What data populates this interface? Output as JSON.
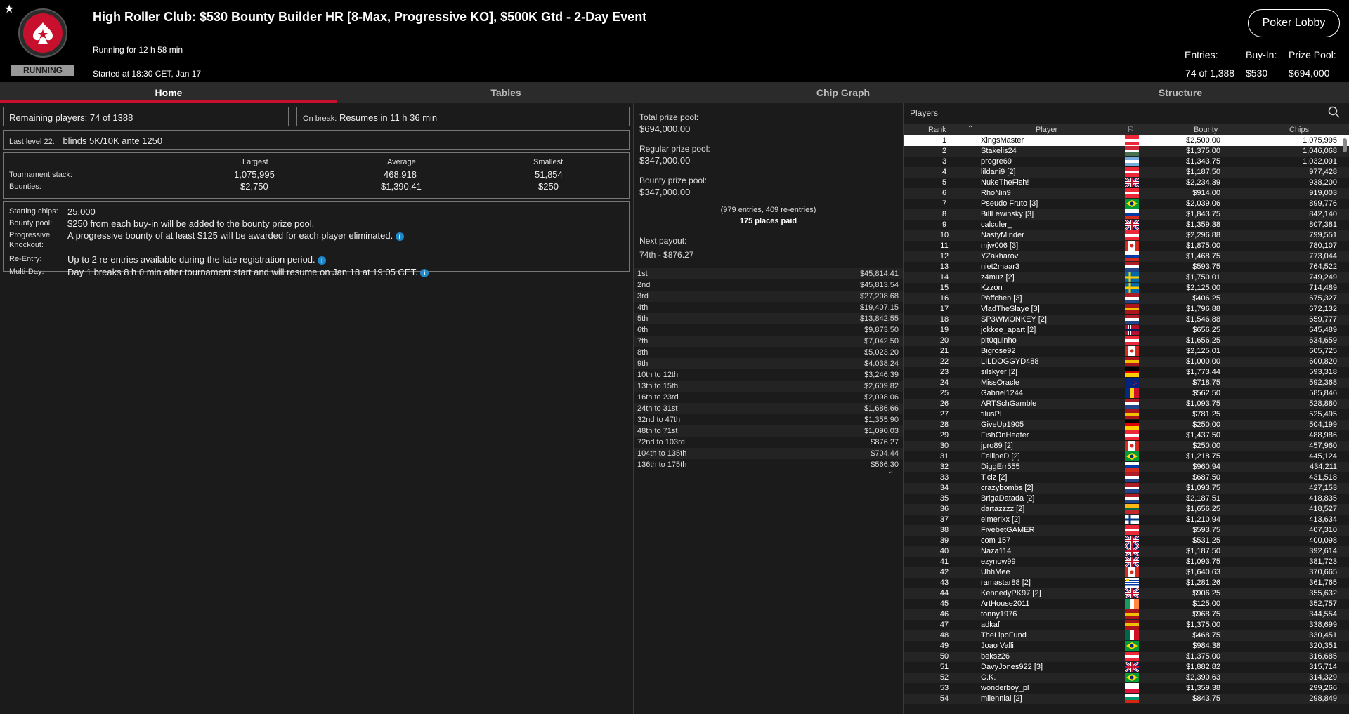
{
  "header": {
    "title": "High Roller Club: $530 Bounty Builder HR [8-Max, Progressive KO], $500K Gtd - 2-Day Event",
    "running_for": "Running for 12 h 58 min",
    "started_at": "Started at 18:30 CET, Jan 17",
    "status_ribbon": "RUNNING",
    "lobby_button": "Poker Lobby",
    "entries_label": "Entries:",
    "entries_value": "74 of 1,388",
    "buyin_label": "Buy-In:",
    "buyin_value": "$530",
    "prizepool_label": "Prize Pool:",
    "prizepool_value": "$694,000",
    "accent_color": "#c8102e"
  },
  "tabs": [
    "Home",
    "Tables",
    "Chip Graph",
    "Structure"
  ],
  "home": {
    "remaining_label": "Remaining players:",
    "remaining_value": "74 of 1388",
    "onbreak_label": "On break:",
    "onbreak_value": "Resumes in 11 h 36 min",
    "lastlevel_label": "Last level 22:",
    "lastlevel_value": "blinds 5K/10K ante 1250",
    "stats": {
      "col_largest": "Largest",
      "col_average": "Average",
      "col_smallest": "Smallest",
      "row_stack": "Tournament stack:",
      "row_bounties": "Bounties:",
      "stack_largest": "1,075,995",
      "stack_average": "468,918",
      "stack_smallest": "51,854",
      "bounty_largest": "$2,750",
      "bounty_average": "$1,390.41",
      "bounty_smallest": "$250"
    },
    "info": {
      "starting_label": "Starting chips:",
      "starting_value": "25,000",
      "bounty_label": "Bounty pool:",
      "bounty_value": "$250 from each buy-in will be added to the bounty prize pool.",
      "pko_label1": "Progressive",
      "pko_label2": "Knockout:",
      "pko_value": "A progressive bounty of at least $125 will be awarded for each player eliminated.",
      "reentry_label": "Re-Entry:",
      "reentry_value": "Up to 2 re-entries available during the late registration period.",
      "multiday_label": "Multi-Day:",
      "multiday_value": "Day 1 breaks 8 h 0 min after tournament start and will resume on Jan 18 at 19:05 CET."
    }
  },
  "prize": {
    "total_label": "Total prize pool:",
    "total_value": "$694,000.00",
    "regular_label": "Regular prize pool:",
    "regular_value": "$347,000.00",
    "bounty_label": "Bounty prize pool:",
    "bounty_value": "$347,000.00",
    "entries_note": "(979 entries, 409 re-entries)",
    "places_paid": "175 places paid",
    "next_payout_label": "Next payout:",
    "next_payout_value": "74th - $876.27",
    "payouts": [
      [
        "1st",
        "$45,814.41"
      ],
      [
        "2nd",
        "$45,813.54"
      ],
      [
        "3rd",
        "$27,208.68"
      ],
      [
        "4th",
        "$19,407.15"
      ],
      [
        "5th",
        "$13,842.55"
      ],
      [
        "6th",
        "$9,873.50"
      ],
      [
        "7th",
        "$7,042.50"
      ],
      [
        "8th",
        "$5,023.20"
      ],
      [
        "9th",
        "$4,038.24"
      ],
      [
        "10th to 12th",
        "$3,246.39"
      ],
      [
        "13th to 15th",
        "$2,609.82"
      ],
      [
        "16th to 23rd",
        "$2,098.06"
      ],
      [
        "24th to 31st",
        "$1,686.66"
      ],
      [
        "32nd to 47th",
        "$1,355.90"
      ],
      [
        "48th to 71st",
        "$1,090.03"
      ],
      [
        "72nd to 103rd",
        "$876.27"
      ],
      [
        "104th to 135th",
        "$704.44"
      ],
      [
        "136th to 175th",
        "$566.30"
      ]
    ]
  },
  "players": {
    "title": "Players",
    "columns": {
      "rank": "Rank",
      "player": "Player",
      "bounty": "Bounty",
      "chips": "Chips"
    },
    "rows": [
      [
        "1",
        "XingsMaster",
        "$2,500.00",
        "1,075,995",
        "at"
      ],
      [
        "2",
        "Stakelis24",
        "$1,375.00",
        "1,046,068",
        "hu"
      ],
      [
        "3",
        "progre69",
        "$1,343.75",
        "1,032,091",
        "ar"
      ],
      [
        "4",
        "lildani9 [2]",
        "$1,187.50",
        "977,428",
        "at"
      ],
      [
        "5",
        "NukeTheFish!",
        "$2,234.39",
        "938,200",
        "gb"
      ],
      [
        "6",
        "RhoNin9",
        "$914.00",
        "919,003",
        "at"
      ],
      [
        "7",
        "Pseudo Fruto [3]",
        "$2,039.06",
        "899,776",
        "br"
      ],
      [
        "8",
        "BillLewinsky [3]",
        "$1,843.75",
        "842,140",
        "ru"
      ],
      [
        "9",
        "calculer_",
        "$1,359.38",
        "807,381",
        "gb"
      ],
      [
        "10",
        "NastyMinder",
        "$2,296.88",
        "799,551",
        "at"
      ],
      [
        "11",
        "mjw006 [3]",
        "$1,875.00",
        "780,107",
        "ca"
      ],
      [
        "12",
        "YZakharov",
        "$1,468.75",
        "773,044",
        "ru"
      ],
      [
        "13",
        "niet2maar3",
        "$593.75",
        "764,522",
        "nl"
      ],
      [
        "14",
        "z4muz [2]",
        "$1,750.01",
        "749,249",
        "se"
      ],
      [
        "15",
        "Kzzon",
        "$2,125.00",
        "714,489",
        "se"
      ],
      [
        "16",
        "Päffchen [3]",
        "$406.25",
        "675,327",
        "nl"
      ],
      [
        "17",
        "VladTheSlaye [3]",
        "$1,796.88",
        "672,132",
        "es"
      ],
      [
        "18",
        "SP3WMONKEY [2]",
        "$1,546.88",
        "659,777",
        "nl"
      ],
      [
        "19",
        "jokkee_apart [2]",
        "$656.25",
        "645,489",
        "no"
      ],
      [
        "20",
        "pit0quinho",
        "$1,656.25",
        "634,659",
        "at"
      ],
      [
        "21",
        "Bigrose92",
        "$2,125.01",
        "605,725",
        "ca"
      ],
      [
        "22",
        "LILDOGGYD488",
        "$1,000.00",
        "600,820",
        "es"
      ],
      [
        "23",
        "silskyer [2]",
        "$1,773.44",
        "593,318",
        "de"
      ],
      [
        "24",
        "MissOracle",
        "$718.75",
        "592,368",
        "nz"
      ],
      [
        "25",
        "Gabriel1244",
        "$562.50",
        "585,846",
        "ro"
      ],
      [
        "26",
        "ARTSchGamble",
        "$1,093.75",
        "528,880",
        "nl"
      ],
      [
        "27",
        "filusPL",
        "$781.25",
        "525,495",
        "es"
      ],
      [
        "28",
        "GiveUp1905",
        "$250.00",
        "504,199",
        "de"
      ],
      [
        "29",
        "FishOnHeater",
        "$1,437.50",
        "488,986",
        "at"
      ],
      [
        "30",
        "jpro89 [2]",
        "$250.00",
        "457,960",
        "ca"
      ],
      [
        "31",
        "FellipeD [2]",
        "$1,218.75",
        "445,124",
        "br"
      ],
      [
        "32",
        "DiggErr555",
        "$960.94",
        "434,211",
        "ru"
      ],
      [
        "33",
        "Ticiz [2]",
        "$687.50",
        "431,518",
        "nl"
      ],
      [
        "34",
        "crazybombs [2]",
        "$1,093.75",
        "427,153",
        "nl"
      ],
      [
        "35",
        "BrigaDatada [2]",
        "$2,187.51",
        "418,835",
        "nl"
      ],
      [
        "36",
        "dartazzzz [2]",
        "$1,656.25",
        "418,527",
        "lt"
      ],
      [
        "37",
        "elmerixx [2]",
        "$1,210.94",
        "413,634",
        "fi"
      ],
      [
        "38",
        "FivebetGAMER",
        "$593.75",
        "407,310",
        "at"
      ],
      [
        "39",
        "com 157",
        "$531.25",
        "400,098",
        "gb"
      ],
      [
        "40",
        "Naza114",
        "$1,187.50",
        "392,614",
        "gb"
      ],
      [
        "41",
        "ezynow99",
        "$1,093.75",
        "381,723",
        "gb"
      ],
      [
        "42",
        "UhhMee",
        "$1,640.63",
        "370,665",
        "ca"
      ],
      [
        "43",
        "ramastar88 [2]",
        "$1,281.26",
        "361,765",
        "uy"
      ],
      [
        "44",
        "KennedyPK97 [2]",
        "$906.25",
        "355,632",
        "gb"
      ],
      [
        "45",
        "ArtHouse2011",
        "$125.00",
        "352,757",
        "ie"
      ],
      [
        "46",
        "tonny1976",
        "$968.75",
        "344,554",
        "es"
      ],
      [
        "47",
        "adkaf",
        "$1,375.00",
        "338,699",
        "es"
      ],
      [
        "48",
        "TheLipoFund",
        "$468.75",
        "330,451",
        "mx"
      ],
      [
        "49",
        "Joao Valli",
        "$984.38",
        "320,351",
        "br"
      ],
      [
        "50",
        "beksz26",
        "$1,375.00",
        "316,685",
        "at"
      ],
      [
        "51",
        "DavyJones922 [3]",
        "$1,882.82",
        "315,714",
        "gb"
      ],
      [
        "52",
        "C.K.",
        "$2,390.63",
        "314,329",
        "br"
      ],
      [
        "53",
        "wonderboy_pl",
        "$1,359.38",
        "299,266",
        "pl"
      ],
      [
        "54",
        "milennial [2]",
        "$843.75",
        "298,849",
        "bg"
      ]
    ]
  }
}
